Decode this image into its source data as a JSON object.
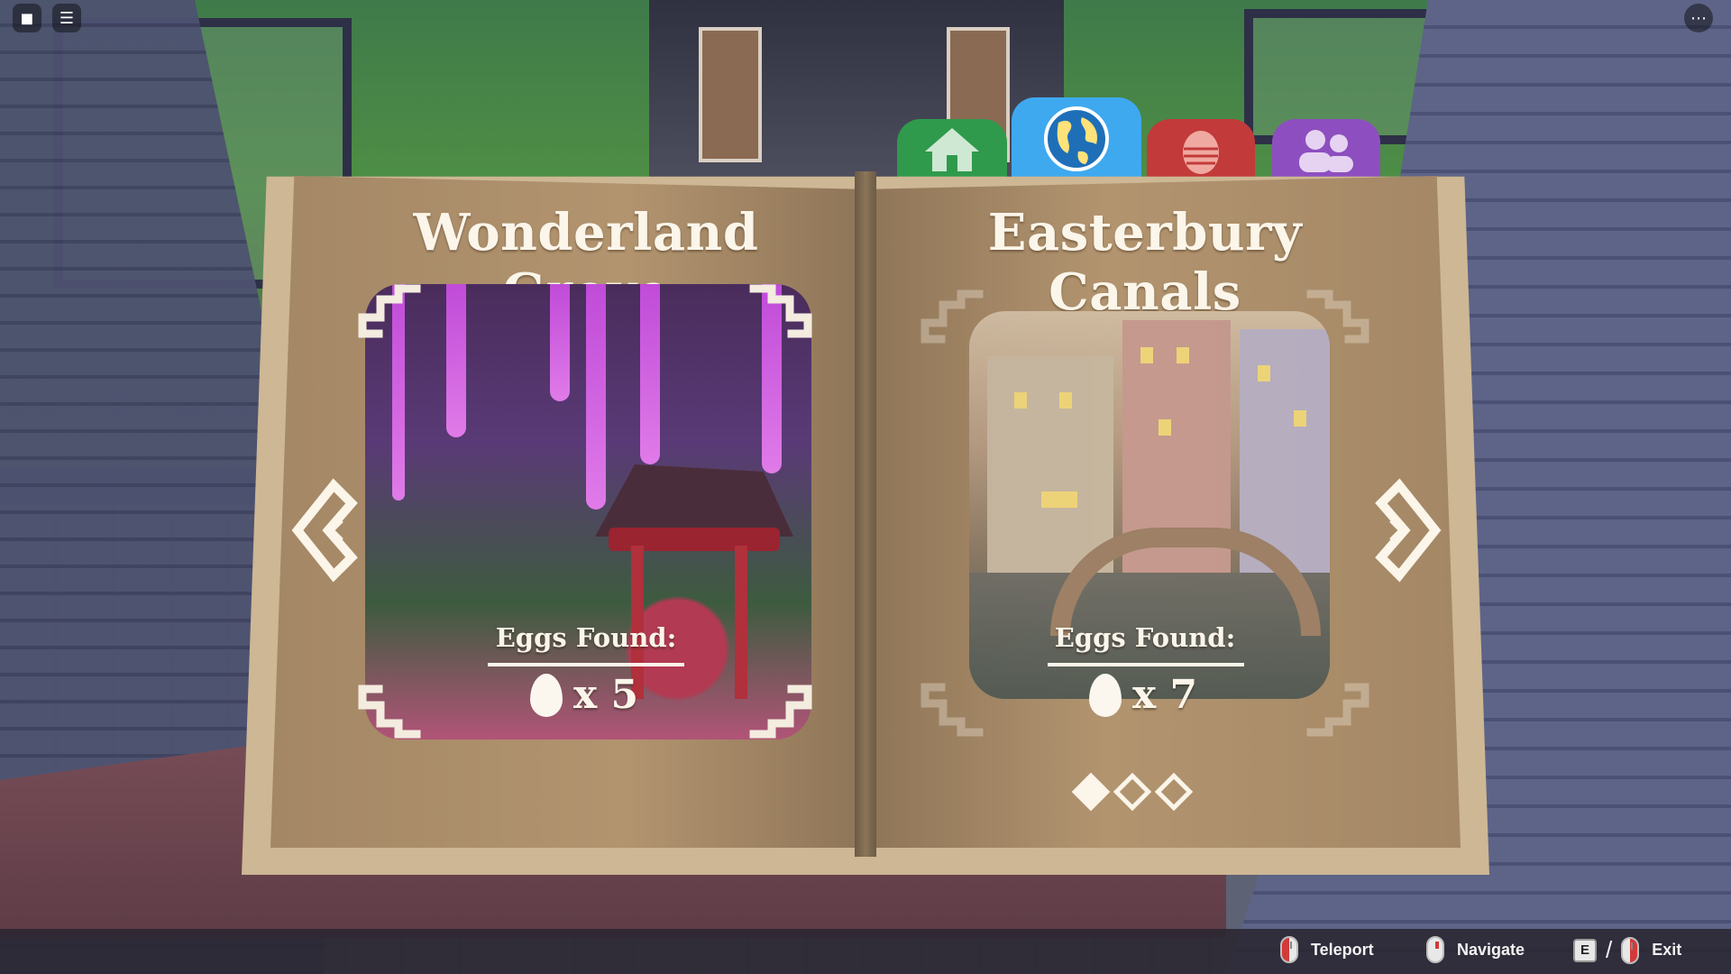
{
  "tabs": [
    {
      "name": "home",
      "icon": "house-icon",
      "color": "#2f9a4c"
    },
    {
      "name": "world",
      "icon": "globe-icon",
      "color": "#3fa9f0",
      "active": true
    },
    {
      "name": "eggs",
      "icon": "egg-icon",
      "color": "#c23a3a"
    },
    {
      "name": "friends",
      "icon": "people-icon",
      "color": "#8d4fbf"
    }
  ],
  "left_page": {
    "title": "Wonderland Grove",
    "eggs_label": "Eggs Found:",
    "eggs_count": "x 5"
  },
  "right_page": {
    "title": "Easterbury Canals",
    "eggs_label": "Eggs Found:",
    "eggs_count": "x 7"
  },
  "pagination": {
    "total": 3,
    "current": 1
  },
  "hints": {
    "teleport": "Teleport",
    "navigate": "Navigate",
    "exit_key": "E",
    "exit_separator": "/",
    "exit": "Exit"
  },
  "colors": {
    "page": "#b2946f",
    "text": "#fbf5ea"
  }
}
